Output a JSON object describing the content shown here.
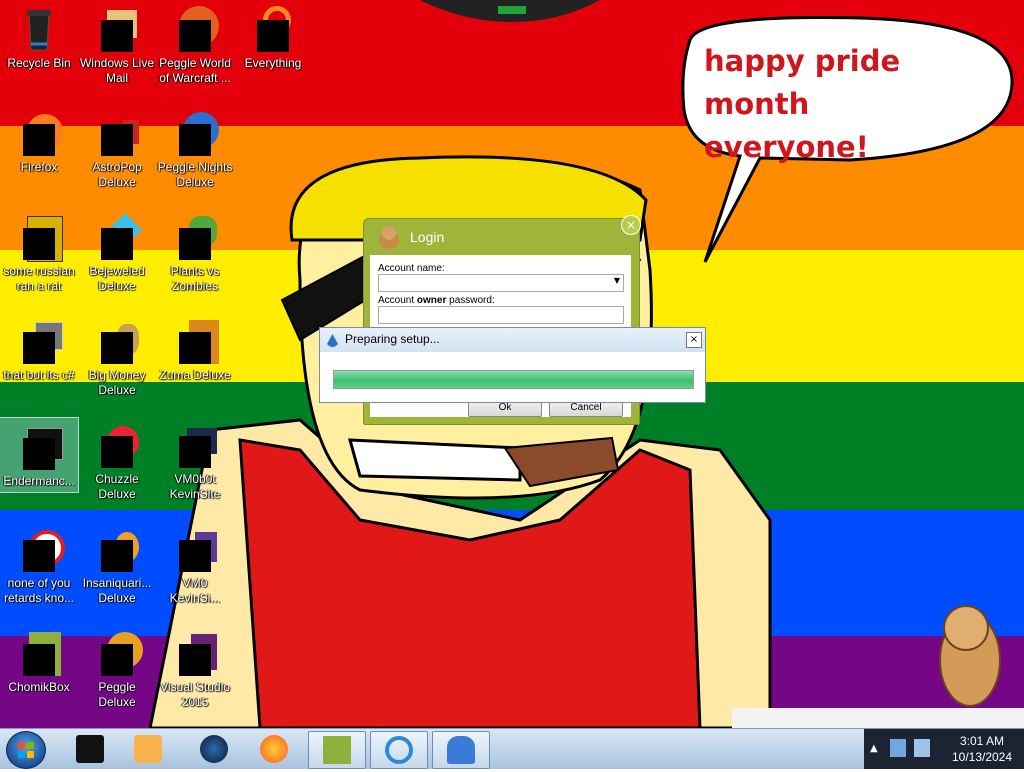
{
  "speech_bubble": {
    "line1": "happy pride month",
    "line2": "everyone!"
  },
  "desktop_icons": [
    {
      "label": "Recycle Bin"
    },
    {
      "label": "Windows Live Mail"
    },
    {
      "label": "Peggle World of Warcraft ..."
    },
    {
      "label": "Everything"
    },
    {
      "label": "Firefox"
    },
    {
      "label": "AstroPop Deluxe"
    },
    {
      "label": "Peggle Nights Deluxe"
    },
    {
      "label": "some russian ran a rat"
    },
    {
      "label": "Bejeweled Deluxe"
    },
    {
      "label": "Plants vs Zombies"
    },
    {
      "label": "that but its c#"
    },
    {
      "label": "Big Money Deluxe"
    },
    {
      "label": "Zuma Deluxe"
    },
    {
      "label": "Endermanc..."
    },
    {
      "label": "Chuzzle Deluxe"
    },
    {
      "label": "VM0b0t KevinSite"
    },
    {
      "label": "none of you retards kno..."
    },
    {
      "label": "Insaniquari... Deluxe"
    },
    {
      "label": "VM0 KevinSi..."
    },
    {
      "label": "ChomikBox"
    },
    {
      "label": "Peggle Deluxe"
    },
    {
      "label": "Visual Studio 2015"
    }
  ],
  "login_window": {
    "title": "Login",
    "close_glyph": "×",
    "account_name_label": "Account name:",
    "password_label_pre": "Account ",
    "password_label_bold": "owner",
    "password_label_post": " password:",
    "ok_label": "Ok",
    "cancel_label": "Cancel"
  },
  "setup_dialog": {
    "title": "Preparing setup...",
    "close_glyph": "×",
    "progress": 1.0
  },
  "taskbar": {
    "time": "3:01 AM",
    "date": "10/13/2024"
  },
  "colors": {
    "stripe_red": "#e4000a",
    "stripe_orange": "#ff8b00",
    "stripe_yellow": "#ffed00",
    "stripe_green": "#008026",
    "stripe_blue": "#004dff",
    "stripe_purple": "#750787",
    "bubble_text": "#d0161c",
    "login_accent": "#9fb53a"
  }
}
